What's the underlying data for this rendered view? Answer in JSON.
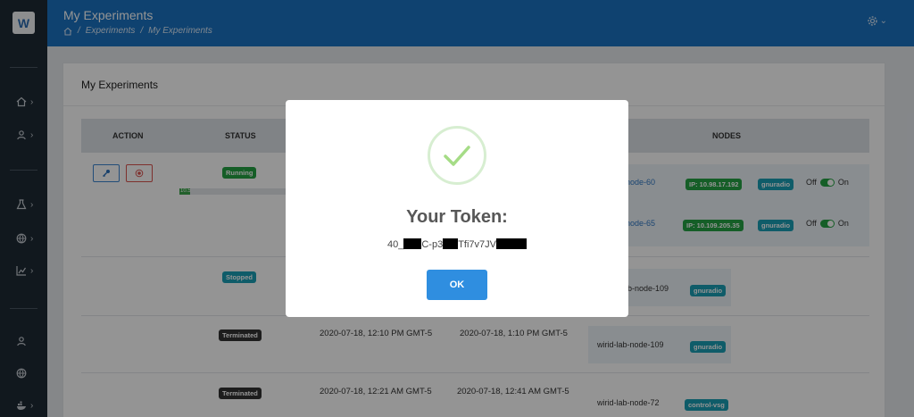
{
  "app": {
    "logo_letter": "W"
  },
  "header": {
    "title": "My Experiments",
    "breadcrumb": [
      "Experiments",
      "My Experiments"
    ],
    "separator": "/"
  },
  "card": {
    "title": "My Experiments",
    "columns": {
      "action": "ACTION",
      "status": "STATUS",
      "nodes": "NODES"
    },
    "rows": [
      {
        "status": "Running",
        "progress_label": "10.5",
        "progress": 0.1,
        "nodes": [
          {
            "name": "b-node-60",
            "ip": "IP: 10.98.17.192",
            "tag": "gnuradio",
            "off": "Off",
            "on": "On"
          },
          {
            "name": "b-node-65",
            "ip": "IP: 10.109.205.35",
            "tag": "gnuradio",
            "off": "Off",
            "on": "On"
          }
        ]
      },
      {
        "status": "Stopped",
        "node": "-lab-node-109",
        "tag": "gnuradio"
      },
      {
        "status": "Terminated",
        "start": "2020-07-18, 12:10 PM GMT-5",
        "end": "2020-07-18, 1:10 PM GMT-5",
        "node": "wirid-lab-node-109",
        "tag": "gnuradio"
      },
      {
        "status": "Terminated",
        "start": "2020-07-18, 12:21 AM GMT-5",
        "end": "2020-07-18, 12:41 AM GMT-5",
        "node": "wirid-lab-node-72",
        "tag": "control-vsg"
      }
    ]
  },
  "modal": {
    "title": "Your Token:",
    "token_parts": [
      "40_",
      "C-p3",
      "Tfi7v7JV"
    ],
    "ok_label": "OK"
  },
  "colors": {
    "header": "#1a73c2",
    "sidebar": "#1e2a35",
    "success": "#25a244",
    "info": "#1a9fb5",
    "ok_button": "#2f8ee0"
  }
}
